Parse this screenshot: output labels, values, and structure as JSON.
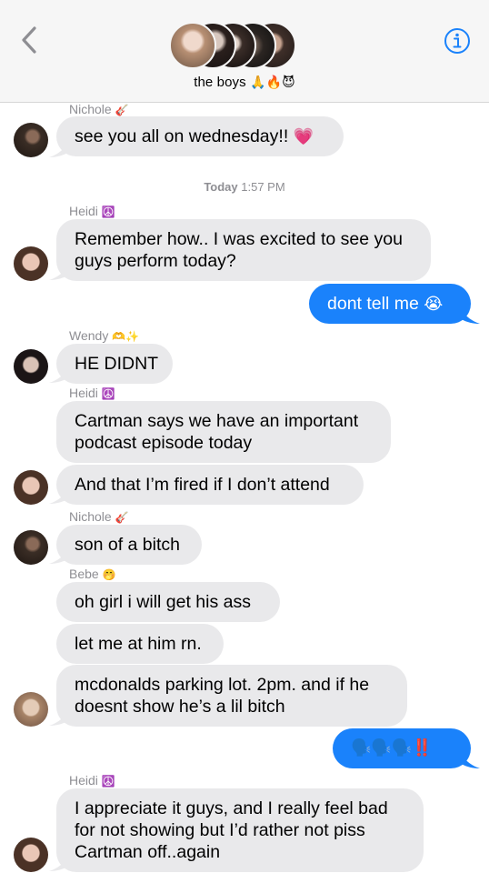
{
  "header": {
    "group_name": "the boys",
    "group_emoji": "🙏🔥😈",
    "back_icon": "chevron-left-icon",
    "info_icon": "info-icon",
    "accent_color": "#1a82fb"
  },
  "messages": {
    "m1": {
      "sender": "Nichole",
      "sender_emoji": "🎸",
      "text": "see you all on wednesday!!",
      "emoji": "💗"
    },
    "timestamp": {
      "day": "Today",
      "time": "1:57 PM"
    },
    "m2": {
      "sender": "Heidi",
      "sender_emoji": "☮️",
      "line1": "Remember how.. I was excited to see you",
      "line2": "guys perform today?"
    },
    "m3": {
      "text": "dont tell me",
      "emoji": "😭"
    },
    "m4": {
      "sender": "Wendy",
      "sender_emoji": "🫶✨",
      "text": "HE DIDNT"
    },
    "m5": {
      "sender": "Heidi",
      "sender_emoji": "☮️",
      "line1": "Cartman says we have an important",
      "line2": "podcast episode today"
    },
    "m6": {
      "text": "And that I’m fired if I don’t attend"
    },
    "m7": {
      "sender": "Nichole",
      "sender_emoji": "🎸",
      "text": "son of a bitch"
    },
    "m8": {
      "sender": "Bebe",
      "sender_emoji": "🤭",
      "text": "oh girl i will get his ass"
    },
    "m9": {
      "text": "let me at him rn."
    },
    "m10": {
      "line1": "mcdonalds parking lot. 2pm. and if he",
      "line2": "doesnt show he’s a lil bitch"
    },
    "m11": {
      "text": "🗣️🗣️🗣️‼️"
    },
    "m12": {
      "sender": "Heidi",
      "sender_emoji": "☮️",
      "line1": "I appreciate it guys, and I really feel bad",
      "line2": "for not showing but I’d rather not piss",
      "line3": "Cartman off..again"
    }
  }
}
